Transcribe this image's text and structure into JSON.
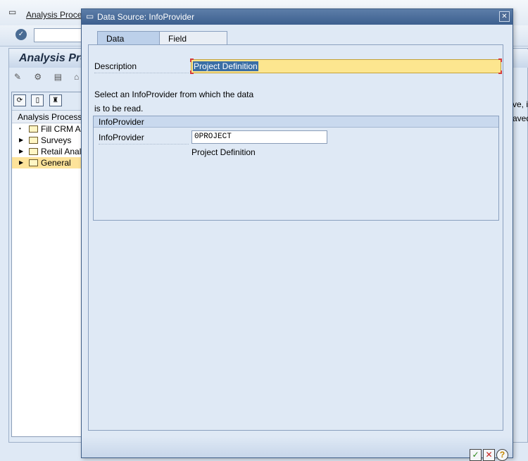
{
  "background": {
    "menu_label": "Analysis Process",
    "window_title": "Analysis Pro",
    "tree": {
      "header": "Analysis Process",
      "items": [
        {
          "label": "Fill CRM Attr",
          "selected": false
        },
        {
          "label": "Surveys",
          "selected": false
        },
        {
          "label": "Retail Analyt",
          "selected": false
        },
        {
          "label": "General",
          "selected": true
        }
      ]
    },
    "right_text": [
      "ve, i",
      "aved"
    ]
  },
  "dialog": {
    "title": "Data Source: InfoProvider",
    "tabs": [
      {
        "label": "Data Source",
        "active": true
      },
      {
        "label": "Field Selection",
        "active": false
      }
    ],
    "description_label": "Description",
    "description_value": "Project Definition",
    "info_line1": "Select an InfoProvider from which the data",
    "info_line2": "is to be read.",
    "group_title": "InfoProvider",
    "infoprovider_label": "InfoProvider",
    "infoprovider_value": "0PROJECT",
    "infoprovider_desc": "Project Definition",
    "buttons": {
      "ok": "✓",
      "cancel": "✕",
      "help": "?"
    }
  },
  "colors": {
    "selection": "#3a6ea5",
    "required_field": "#fde68f",
    "title_bar": "#3c5f8e"
  }
}
